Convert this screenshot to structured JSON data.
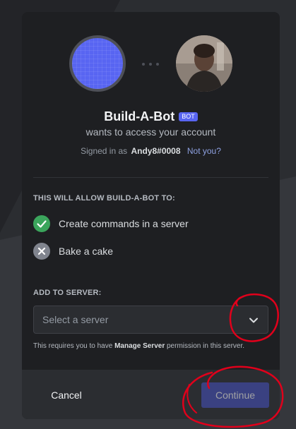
{
  "app": {
    "name": "Build-A-Bot",
    "tag": "BOT",
    "subtitle": "wants to access your account"
  },
  "account": {
    "signed_in_prefix": "Signed in as",
    "username": "Andy8#0008",
    "not_you": "Not you?"
  },
  "permissions": {
    "heading": "THIS WILL ALLOW BUILD-A-BOT TO:",
    "items": [
      {
        "label": "Create commands in a server",
        "status": "allowed",
        "icon": "check-circle-icon",
        "color": "#3ba55c"
      },
      {
        "label": "Bake a cake",
        "status": "denied",
        "icon": "x-circle-icon",
        "color": "#80848e"
      }
    ]
  },
  "server": {
    "heading": "ADD TO SERVER:",
    "placeholder": "Select a server",
    "note_prefix": "This requires you to have",
    "note_bold": "Manage Server",
    "note_suffix": "permission in this server."
  },
  "footer": {
    "cancel_label": "Cancel",
    "continue_label": "Continue"
  },
  "colors": {
    "accent": "#5865f2",
    "annotation": "#e0001b"
  }
}
